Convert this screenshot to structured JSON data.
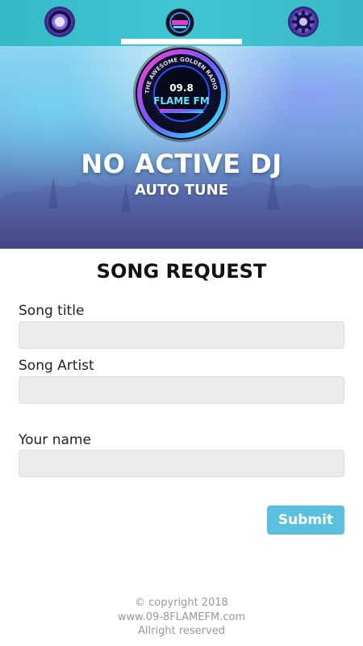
{
  "tabs": [
    {
      "name": "home",
      "icon": "radio-logo-icon"
    },
    {
      "name": "logo",
      "icon": "flame-fm-logo-icon"
    },
    {
      "name": "gear",
      "icon": "gear-logo-icon"
    }
  ],
  "active_tab_index": 1,
  "hero": {
    "dj_name": "NO ACTIVE DJ",
    "show": "AUTO TUNE",
    "logo_text": {
      "ring": "THE AWESOME GOLDEN RADIO",
      "number": "09.8",
      "brand": "FLAME FM"
    }
  },
  "form": {
    "title": "SONG REQUEST",
    "song_title_label": "Song title",
    "song_title_value": "",
    "song_artist_label": "Song Artist",
    "song_artist_value": "",
    "your_name_label": "Your name",
    "your_name_value": "",
    "submit_label": "Submit"
  },
  "footer": {
    "copyright": "© copyright 2018",
    "website": "www.09-8FLAMEFM.com",
    "rights": "Allright reserved"
  },
  "colors": {
    "tabbar": "#3fc6d4",
    "submit": "#5bc0de",
    "field_bg": "#ececec"
  }
}
